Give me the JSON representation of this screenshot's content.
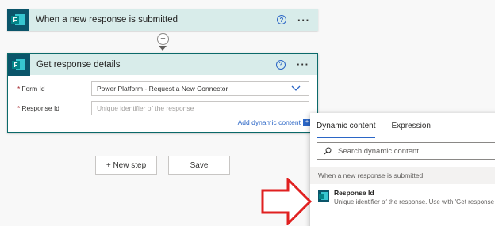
{
  "trigger": {
    "title": "When a new response is submitted",
    "help_icon": "?",
    "more_icon": "···"
  },
  "connector": {
    "plus": "+"
  },
  "action": {
    "title": "Get response details",
    "help_icon": "?",
    "more_icon": "···",
    "fields": [
      {
        "label": "Form Id",
        "value": "Power Platform - Request a New Connector",
        "required": "*"
      },
      {
        "label": "Response Id",
        "placeholder": "Unique identifier of the response",
        "required": "*"
      }
    ],
    "add_dynamic_content": "Add dynamic content",
    "add_dynamic_badge": "+"
  },
  "buttons": {
    "new_step": "+ New step",
    "save": "Save"
  },
  "dynamic_panel": {
    "tabs": [
      "Dynamic content",
      "Expression"
    ],
    "active_tab": "Dynamic content",
    "search_placeholder": "Search dynamic content",
    "section_title": "When a new response is submitted",
    "items": [
      {
        "title": "Response Id",
        "description": "Unique identifier of the response. Use with 'Get response d"
      }
    ]
  },
  "colors": {
    "header_bg": "#d8ecea",
    "icon_bg": "#0b556a",
    "accent_blue": "#2b66c6",
    "arrow_red": "#e02020"
  }
}
